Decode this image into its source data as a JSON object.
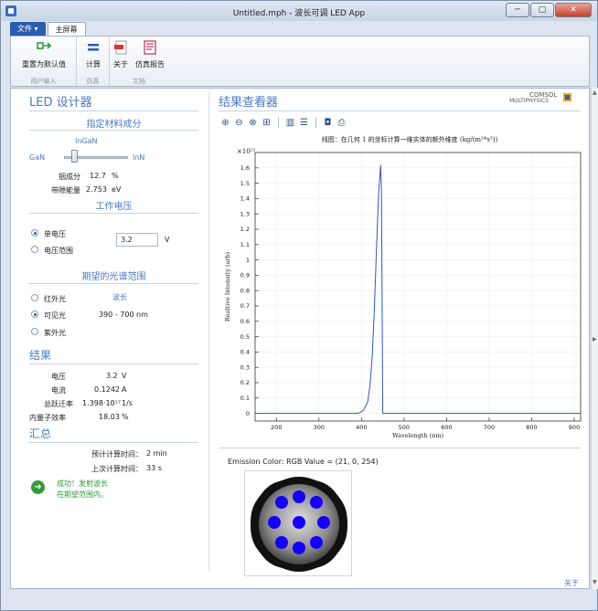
{
  "window": {
    "title": "Untitled.mph - 波长可调 LED App",
    "min": "─",
    "max": "▢",
    "close": "✕"
  },
  "tabs": {
    "file": "文件 ▾",
    "home": "主屏幕"
  },
  "ribbon": {
    "reset": "重置为默认值",
    "compute": "计算",
    "about": "关于",
    "report": "仿真报告",
    "group_input": "用户输入",
    "group_sim": "仿真",
    "group_doc": "文档"
  },
  "left": {
    "title": "LED 设计器",
    "material_section": "指定材料成分",
    "material_name": "InGaN",
    "gan": "GaN",
    "inn": "InN",
    "slider_fraction": 0.127,
    "indium_label": "铟成分",
    "indium_value": "12.7",
    "indium_unit": "%",
    "bandgap_label": "带隙能量",
    "bandgap_value": "2.753",
    "bandgap_unit": "eV",
    "voltage_section": "工作电压",
    "single_voltage": "单电压",
    "voltage_range": "电压范围",
    "voltage_value": "3.2",
    "voltage_unit": "V",
    "spectrum_section": "期望的光谱范围",
    "wavelength_label": "波长",
    "infrared": "红外光",
    "visible": "可见光",
    "visible_range": "390 - 700 nm",
    "ultraviolet": "紫外光",
    "results_title": "结果",
    "res_voltage_label": "电压",
    "res_voltage_value": "3.2",
    "res_voltage_unit": "V",
    "res_current_label": "电流",
    "res_current_value": "0.1242",
    "res_current_unit": "A",
    "res_rate_label": "总跃迁率",
    "res_rate_value": "1.398·10¹⁷",
    "res_rate_unit": "1/s",
    "res_eff_label": "内量子效率",
    "res_eff_value": "18.03",
    "res_eff_unit": "%",
    "summary_title": "汇总",
    "expected_time_label": "预计计算时间：",
    "expected_time_value": "2 min",
    "last_time_label": "上次计算时间：",
    "last_time_value": "33 s",
    "success_line1": "成功！发射波长",
    "success_line2": "在期望范围内。"
  },
  "right": {
    "title": "结果查看器",
    "logo_top": "COMSOL",
    "logo_bottom": "MULTIPHYSICS",
    "emission_label": "Emission Color: RGB Value = (21, 0, 254)",
    "about_link": "关于"
  },
  "colors": {
    "accent": "#4a7ac2",
    "curve": "#3355cc",
    "led": "#1500fe",
    "success": "#2e9c3b"
  },
  "chart_data": {
    "type": "line",
    "title": "线图：在几何 1 的坐标计算一维实体的额外维度 (kg/(m²*s³))",
    "xlabel": "Wavelength (nm)",
    "ylabel": "Realtive Intensity (arb)",
    "y_multiplier": "×10²²",
    "xlim": [
      150,
      915
    ],
    "ylim": [
      -0.05,
      1.7
    ],
    "xticks": [
      200,
      300,
      400,
      500,
      600,
      700,
      800,
      900
    ],
    "yticks": [
      0,
      0.1,
      0.2,
      0.3,
      0.4,
      0.5,
      0.6,
      0.7,
      0.8,
      0.9,
      1.0,
      1.1,
      1.2,
      1.3,
      1.4,
      1.5,
      1.6
    ],
    "series": [
      {
        "x": [
          150,
          380,
          395,
          405,
          415,
          420,
          425,
          430,
          435,
          440,
          445,
          447,
          450,
          600,
          915
        ],
        "y": [
          0,
          0,
          0.003,
          0.02,
          0.08,
          0.18,
          0.36,
          0.66,
          1.05,
          1.42,
          1.62,
          1.45,
          0,
          0,
          0
        ]
      }
    ]
  }
}
